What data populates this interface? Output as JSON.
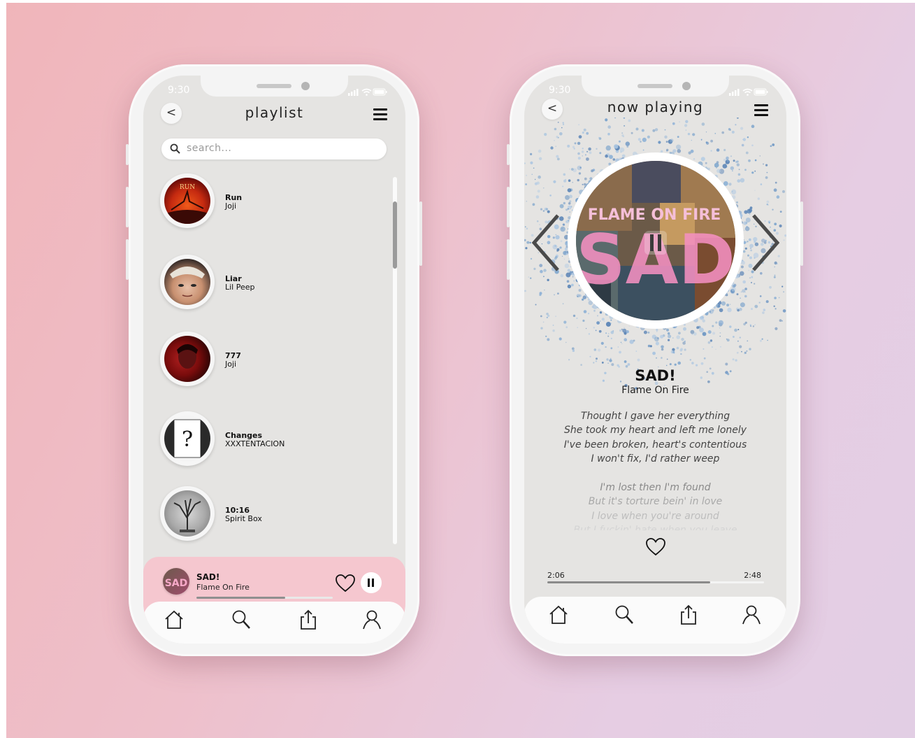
{
  "colors": {
    "accent_pink": "#f5c7cf",
    "screen_bg": "#e5e4e2"
  },
  "playlist_screen": {
    "status_time": "9:30",
    "title": "playlist",
    "back_label": "<",
    "search_placeholder": "search...",
    "songs": [
      {
        "title": "Run",
        "artist": "Joji"
      },
      {
        "title": "Liar",
        "artist": "Lil Peep"
      },
      {
        "title": "777",
        "artist": "Joji"
      },
      {
        "title": "Changes",
        "artist": "XXXTENTACION"
      },
      {
        "title": "10:16",
        "artist": "Spirit Box"
      }
    ],
    "mini_player": {
      "title": "SAD!",
      "artist": "Flame On Fire",
      "progress": 0.65
    },
    "tabs": [
      "home-icon",
      "search-icon",
      "share-icon",
      "profile-icon"
    ]
  },
  "now_playing_screen": {
    "status_time": "9:30",
    "title": "now playing",
    "back_label": "<",
    "album_text_top": "FLAME ON FIRE",
    "album_text_big": "SAD",
    "song_title": "SAD!",
    "artist": "Flame On Fire",
    "lyrics": [
      "Thought I gave her everything",
      "She took my heart and left me lonely",
      "I've been broken, heart's contentious",
      "I won't fix, I'd rather weep",
      "I'm lost then I'm found",
      "But it's torture bein' in love",
      "I love when you're around",
      "But I fuckin' hate when you leave"
    ],
    "time_elapsed": "2:06",
    "time_total": "2:48",
    "progress": 0.75,
    "tabs": [
      "home-icon",
      "search-icon",
      "share-icon",
      "profile-icon"
    ]
  }
}
